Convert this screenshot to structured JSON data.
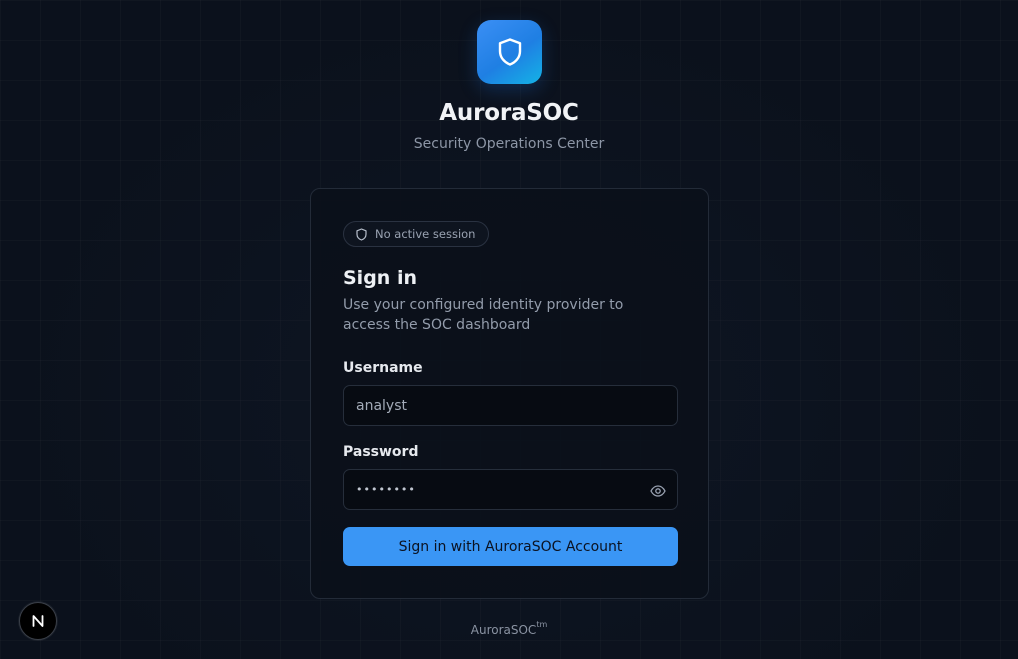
{
  "brand": {
    "title": "AuroraSOC",
    "subtitle": "Security Operations Center",
    "logo_icon": "shield-icon",
    "accent": "#3a96f5"
  },
  "card": {
    "session_badge": "No active session",
    "title": "Sign in",
    "description": "Use your configured identity provider to access the SOC dashboard",
    "username": {
      "label": "Username",
      "value": "analyst"
    },
    "password": {
      "label": "Password",
      "value": "••••••••",
      "toggle_icon": "eye-icon"
    },
    "submit_label": "Sign in with AuroraSOC Account"
  },
  "footer": {
    "text": "AuroraSOC",
    "mark": "tm"
  },
  "devtools": {
    "badge_letter": "N"
  }
}
